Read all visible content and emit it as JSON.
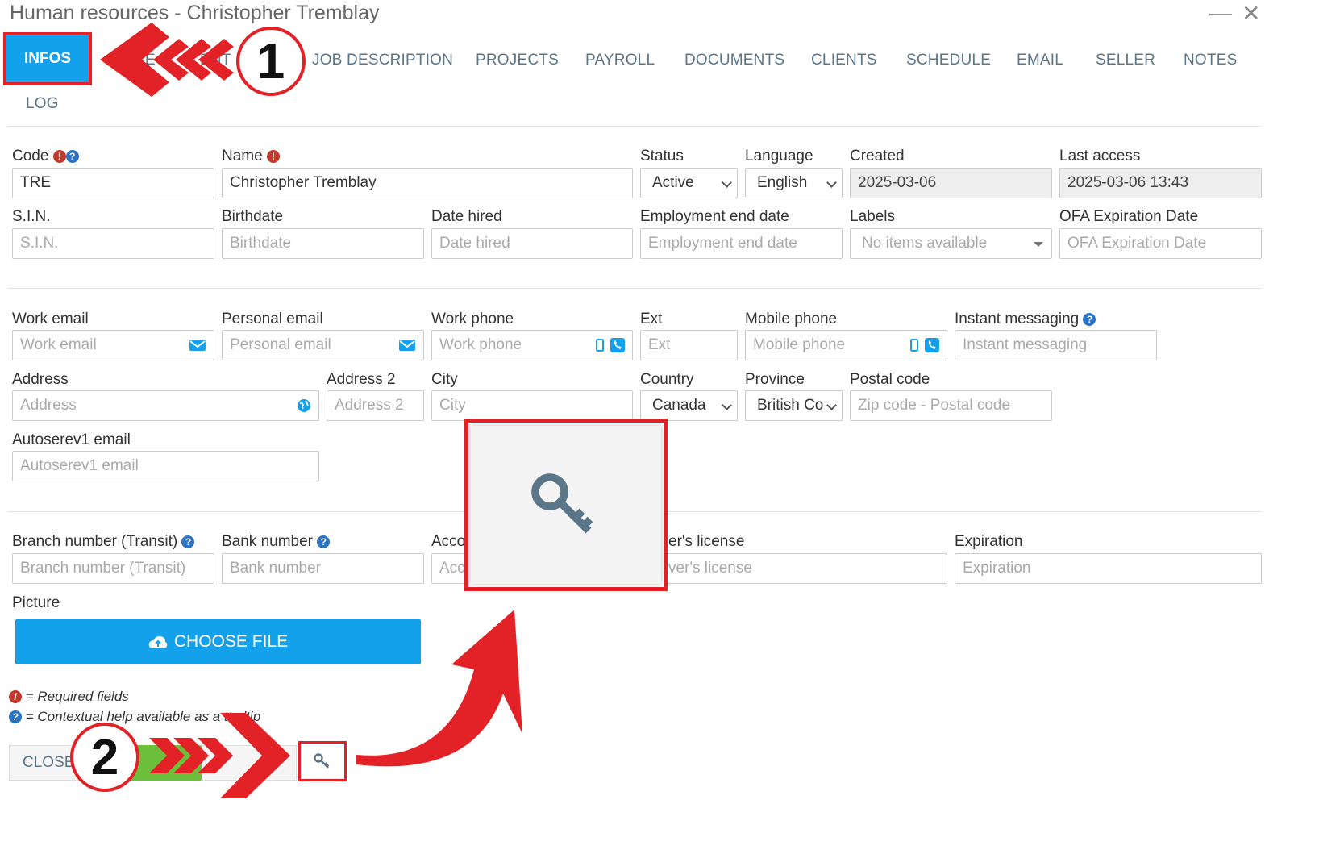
{
  "window": {
    "title": "Human resources - Christopher Tremblay",
    "minimize": "—",
    "close": "✕"
  },
  "tabs": [
    "INFOS",
    "RE",
    "ENT",
    "JOB DESCRIPTION",
    "PROJECTS",
    "PAYROLL",
    "DOCUMENTS",
    "CLIENTS",
    "SCHEDULE",
    "EMAIL",
    "SELLER",
    "NOTES",
    "LOG"
  ],
  "fields": {
    "code": {
      "label": "Code",
      "value": "TRE"
    },
    "name": {
      "label": "Name",
      "value": "Christopher Tremblay"
    },
    "status": {
      "label": "Status",
      "value": "Active"
    },
    "language": {
      "label": "Language",
      "value": "English"
    },
    "created": {
      "label": "Created",
      "value": "2025-03-06"
    },
    "last_access": {
      "label": "Last access",
      "value": "2025-03-06 13:43"
    },
    "sin": {
      "label": "S.I.N.",
      "placeholder": "S.I.N."
    },
    "birthdate": {
      "label": "Birthdate",
      "placeholder": "Birthdate"
    },
    "date_hired": {
      "label": "Date hired",
      "placeholder": "Date hired"
    },
    "end_date": {
      "label": "Employment end date",
      "placeholder": "Employment end date"
    },
    "labels": {
      "label": "Labels",
      "placeholder": "No items available"
    },
    "ofa": {
      "label": "OFA Expiration Date",
      "placeholder": "OFA Expiration Date"
    },
    "work_email": {
      "label": "Work email",
      "placeholder": "Work email"
    },
    "personal_email": {
      "label": "Personal email",
      "placeholder": "Personal email"
    },
    "work_phone": {
      "label": "Work phone",
      "placeholder": "Work phone"
    },
    "ext": {
      "label": "Ext",
      "placeholder": "Ext"
    },
    "mobile_phone": {
      "label": "Mobile phone",
      "placeholder": "Mobile phone"
    },
    "im": {
      "label": "Instant messaging",
      "placeholder": "Instant messaging"
    },
    "address": {
      "label": "Address",
      "placeholder": "Address"
    },
    "address2": {
      "label": "Address 2",
      "placeholder": "Address 2"
    },
    "city": {
      "label": "City",
      "placeholder": "City"
    },
    "country": {
      "label": "Country",
      "value": "Canada"
    },
    "province": {
      "label": "Province",
      "value": "British Co"
    },
    "postal": {
      "label": "Postal code",
      "placeholder": "Zip code - Postal code"
    },
    "autoserev": {
      "label": "Autoserev1 email",
      "placeholder": "Autoserev1 email"
    },
    "branch": {
      "label": "Branch number (Transit)",
      "placeholder": "Branch number (Transit)"
    },
    "bank": {
      "label": "Bank number",
      "placeholder": "Bank number"
    },
    "account": {
      "label": "Acco",
      "placeholder": "Acc"
    },
    "license": {
      "label": "er's license",
      "placeholder": "ver's license"
    },
    "expiration": {
      "label": "Expiration",
      "placeholder": "Expiration"
    },
    "picture": {
      "label": "Picture"
    }
  },
  "choose_file": "CHOOSE FILE",
  "legend": {
    "required": "= Required fields",
    "help": "= Contextual help available as a tooltip"
  },
  "buttons": {
    "close": "CLOSE",
    "save": "E"
  },
  "callouts": [
    "1",
    "2"
  ],
  "colors": {
    "accent": "#12a1ea",
    "annotation": "#e32227",
    "save": "#6cbf3b"
  }
}
